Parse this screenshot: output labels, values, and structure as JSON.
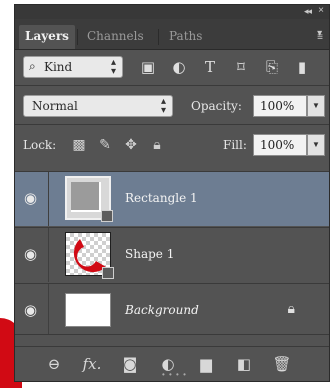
{
  "tabs": [
    {
      "label": "Layers",
      "active": true
    },
    {
      "label": "Channels",
      "active": false
    },
    {
      "label": "Paths",
      "active": false
    }
  ],
  "filter": {
    "kind_label": "Kind",
    "icons": [
      "image-filter-icon",
      "adjustment-filter-icon",
      "type-filter-icon",
      "shape-filter-icon",
      "smart-object-filter-icon"
    ]
  },
  "blend": {
    "mode": "Normal",
    "opacity_label": "Opacity:",
    "opacity_value": "100%"
  },
  "lock": {
    "label": "Lock:",
    "fill_label": "Fill:",
    "fill_value": "100%"
  },
  "layers": [
    {
      "name": "Rectangle 1",
      "selected": true,
      "visible": true
    },
    {
      "name": "Shape 1",
      "selected": false,
      "visible": true
    },
    {
      "name": "Background",
      "selected": false,
      "visible": true,
      "locked": true
    }
  ],
  "footer_icons": [
    "link-layers-icon",
    "fx-icon",
    "mask-icon",
    "adjustment-layer-icon",
    "folder-icon",
    "new-layer-icon",
    "trash-icon"
  ],
  "colors": {
    "panel": "#535353",
    "selected_row": "#6d7d92",
    "tab_bar": "#3c3c3c",
    "accent_red": "#d10a14"
  }
}
